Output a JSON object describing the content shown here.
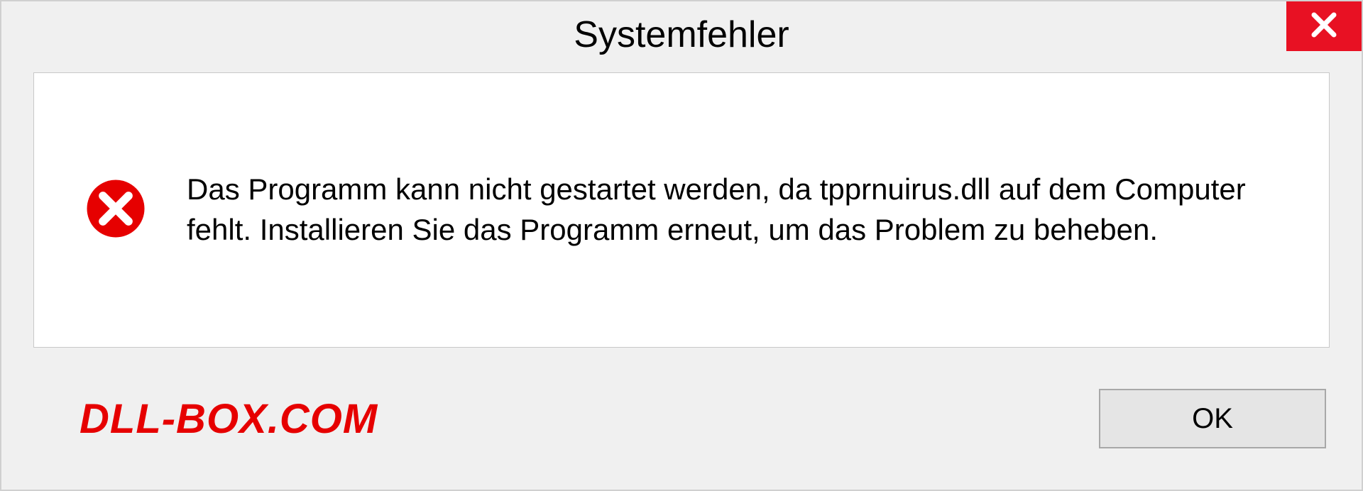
{
  "title": "Systemfehler",
  "message": "Das Programm kann nicht gestartet werden, da tpprnuirus.dll auf dem Computer fehlt. Installieren Sie das Programm erneut, um das Problem zu beheben.",
  "watermark": "DLL-BOX.COM",
  "ok_label": "OK"
}
